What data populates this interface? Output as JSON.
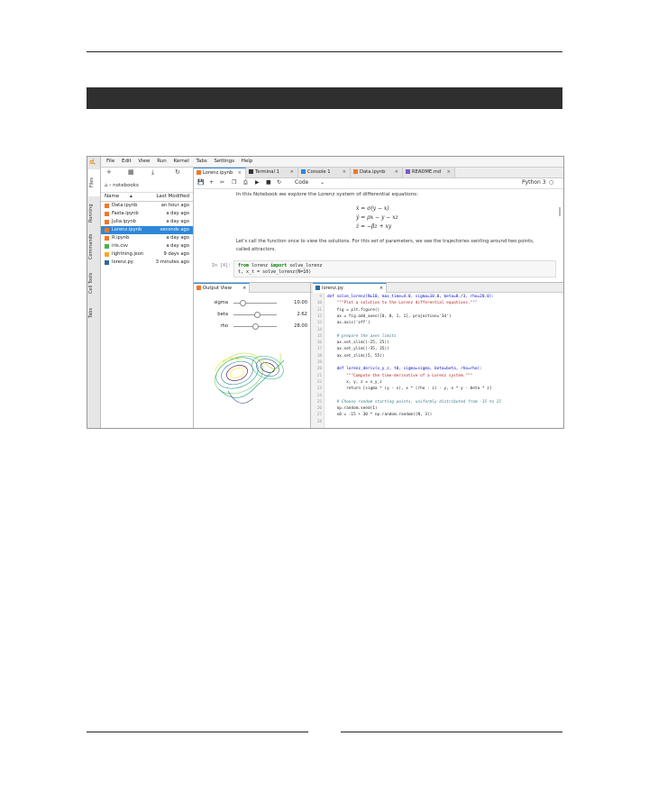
{
  "app": {
    "logo_text": "JL",
    "menu": [
      "File",
      "Edit",
      "View",
      "Run",
      "Kernel",
      "Tabs",
      "Settings",
      "Help"
    ],
    "left_tabs": [
      "Files",
      "Running",
      "Commands",
      "Cell Tools",
      "Tabs"
    ]
  },
  "file_browser": {
    "breadcrumb": "⌂ › notebooks",
    "col_name": "Name",
    "col_modified": "Last Modified",
    "files": [
      {
        "name": "Data.ipynb",
        "modified": "an hour ago",
        "icon": "notebook-icon",
        "color": "#f37626"
      },
      {
        "name": "Fasta.ipynb",
        "modified": "a day ago",
        "icon": "notebook-icon",
        "color": "#f37626"
      },
      {
        "name": "Julia.ipynb",
        "modified": "a day ago",
        "icon": "notebook-icon",
        "color": "#f37626"
      },
      {
        "name": "Lorenz.ipynb",
        "modified": "seconds ago",
        "icon": "notebook-icon",
        "color": "#f37626",
        "selected": true
      },
      {
        "name": "R.ipynb",
        "modified": "a day ago",
        "icon": "notebook-icon",
        "color": "#f37626"
      },
      {
        "name": "iris.csv",
        "modified": "a day ago",
        "icon": "spreadsheet-icon",
        "color": "#4caf50"
      },
      {
        "name": "lightning.json",
        "modified": "9 days ago",
        "icon": "json-icon",
        "color": "#f9a825"
      },
      {
        "name": "lorenz.py",
        "modified": "3 minutes ago",
        "icon": "python-icon",
        "color": "#306998"
      }
    ]
  },
  "tabs": [
    {
      "label": "Lorenz.ipynb",
      "icon": "notebook-icon",
      "color": "#f37626",
      "active": true
    },
    {
      "label": "Terminal 1",
      "icon": "terminal-icon",
      "color": "#333333"
    },
    {
      "label": "Console 1",
      "icon": "console-icon",
      "color": "#2e87d8"
    },
    {
      "label": "Data.ipynb",
      "icon": "notebook-icon",
      "color": "#f37626"
    },
    {
      "label": "README.md",
      "icon": "markdown-icon",
      "color": "#7e57c2"
    }
  ],
  "toolbar": {
    "cell_type": "Code",
    "kernel": "Python 3"
  },
  "notebook": {
    "intro": "In this Notebook we explore the Lorenz system of differential equations:",
    "eq1": "ẋ = σ(y − x)",
    "eq2": "ẏ = ρx − y − xz",
    "eq3": "ż = −βz + xy",
    "para1": "Let's call the function once to view the solutions. For this set of parameters, we see the trajectories swirling around two points,",
    "para2": "called attractors.",
    "prompt": "In [4]:",
    "code_kw1": "from",
    "code_mod": " lorenz ",
    "code_kw2": "import",
    "code_fn": " solve_lorenz",
    "code_line2": "t, x_t = solve_lorenz(N=10)"
  },
  "output_view": {
    "tab_label": "Output View",
    "sliders": [
      {
        "label": "sigma",
        "value": "10.00",
        "level": 0.2
      },
      {
        "label": "beta",
        "value": "2.62",
        "level": 0.55
      },
      {
        "label": "rho",
        "value": "28.00",
        "level": 0.5
      }
    ]
  },
  "editor": {
    "tab_label": "lorenz.py",
    "lines": [
      {
        "n": "9",
        "t": "def solve_lorenz(N=10, max_time=4.0, sigma=10.0, beta=8./3, rho=28.0):"
      },
      {
        "n": "10",
        "t": "    \"\"\"Plot a solution to the Lorenz differential equations.\"\"\""
      },
      {
        "n": "11",
        "t": "    fig = plt.figure()"
      },
      {
        "n": "12",
        "t": "    ax = fig.add_axes([0, 0, 1, 1], projection='3d')"
      },
      {
        "n": "13",
        "t": "    ax.axis('off')"
      },
      {
        "n": "14",
        "t": ""
      },
      {
        "n": "15",
        "t": "    # prepare the axes limits"
      },
      {
        "n": "16",
        "t": "    ax.set_xlim((-25, 25))"
      },
      {
        "n": "17",
        "t": "    ax.set_ylim((-35, 35))"
      },
      {
        "n": "18",
        "t": "    ax.set_zlim((5, 55))"
      },
      {
        "n": "19",
        "t": ""
      },
      {
        "n": "20",
        "t": "    def lorenz_deriv(x_y_z, t0, sigma=sigma, beta=beta, rho=rho):"
      },
      {
        "n": "21",
        "t": "        \"\"\"Compute the time-derivative of a Lorenz system.\"\"\""
      },
      {
        "n": "22",
        "t": "        x, y, z = x_y_z"
      },
      {
        "n": "23",
        "t": "        return [sigma * (y - x), x * (rho - z) - y, x * y - beta * z]"
      },
      {
        "n": "24",
        "t": ""
      },
      {
        "n": "25",
        "t": "    # Choose random starting points, uniformly distributed from -15 to 15"
      },
      {
        "n": "26",
        "t": "    np.random.seed(1)"
      },
      {
        "n": "27",
        "t": "    x0 = -15 + 30 * np.random.random((N, 3))"
      },
      {
        "n": "28",
        "t": ""
      }
    ]
  }
}
